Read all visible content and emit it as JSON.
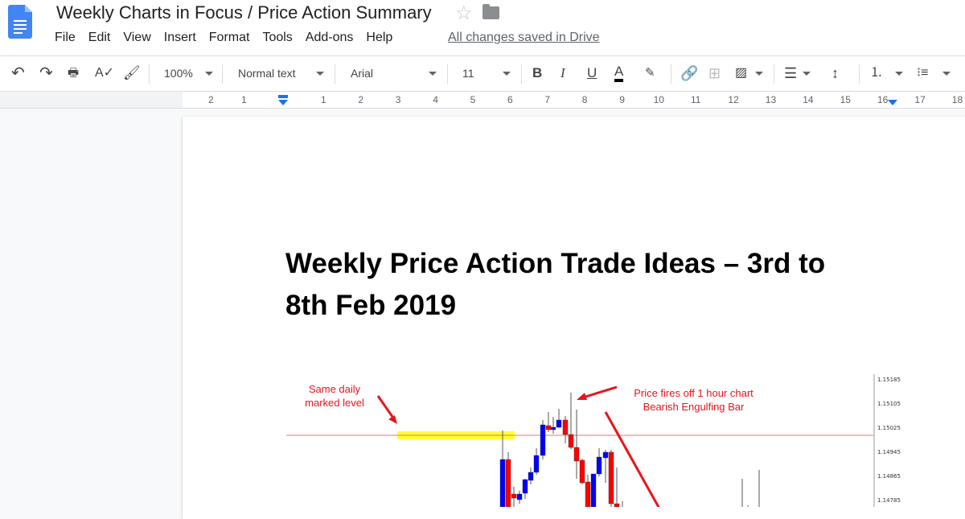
{
  "header": {
    "title": "Weekly Charts in Focus / Price Action Summary",
    "save_status": "All changes saved in Drive",
    "menu": [
      "File",
      "Edit",
      "View",
      "Insert",
      "Format",
      "Tools",
      "Add-ons",
      "Help"
    ]
  },
  "toolbar": {
    "zoom": "100%",
    "style": "Normal text",
    "font": "Arial",
    "size": "11",
    "text_color": "#000000"
  },
  "ruler": {
    "left": [
      "2",
      "1"
    ],
    "right": [
      "1",
      "2",
      "3",
      "4",
      "5",
      "6",
      "7",
      "8",
      "9",
      "10",
      "11",
      "12",
      "13",
      "14",
      "15",
      "16",
      "17",
      "18"
    ]
  },
  "document": {
    "heading_line1": "Weekly Price Action Trade Ideas – 3rd to",
    "heading_line2": "8th Feb 2019",
    "image": {
      "note_left_1": "Same daily",
      "note_left_2": "marked level",
      "note_right_1": "Price fires off 1 hour chart",
      "note_right_2": "Bearish Engulfing Bar",
      "price_axis": [
        "1.15185",
        "1.15105",
        "1.15025",
        "1.14945",
        "1.14865",
        "1.14785"
      ],
      "colors": {
        "bull": "#0000ff",
        "bear": "#ff0000",
        "level": "#ff6b6b",
        "highlight": "#ffff33",
        "annotation": "#e8141b"
      }
    }
  },
  "colors": {
    "accent": "#1a73e8",
    "doc_icon": "#4285f4"
  }
}
